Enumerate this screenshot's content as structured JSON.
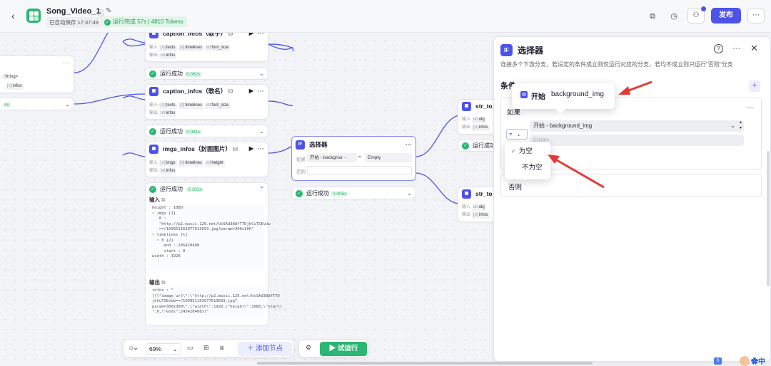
{
  "header": {
    "title": "Song_Video_1",
    "saved_text": "已自动保存 17:37:49",
    "run_status": "运行完成 57s | 4810 Tokens",
    "publish_label": "发布"
  },
  "left_stub": {
    "row1": "String>",
    "row2": "infos",
    "status_time": "4s"
  },
  "nodes": [
    {
      "title": "caption_infos（歌手）",
      "inputs_label": "输入",
      "inputs": [
        "texts",
        "timelines",
        "font_size"
      ],
      "outputs_label": "输出",
      "outputs": [
        "infos"
      ],
      "status": "运行成功",
      "time": "0.082s"
    },
    {
      "title": "caption_infos（歌名）",
      "inputs_label": "输入",
      "inputs": [
        "texts",
        "timelines",
        "font_size"
      ],
      "outputs_label": "输出",
      "outputs": [
        "infos"
      ],
      "status": "运行成功",
      "time": "0.081s"
    },
    {
      "title": "imgs_infos（封面图片）",
      "inputs_label": "输入",
      "inputs": [
        "imgs",
        "timelines",
        "height"
      ],
      "outputs_label": "输出",
      "outputs": [
        "infos"
      ],
      "status": "运行成功",
      "time": "0.101s"
    }
  ],
  "detail": {
    "input_label": "输入",
    "input_lines": [
      "height : 1080",
      "▿ imgs [1]",
      "   0 :",
      "   \"http://p2.music.126.net/UsSAd3BdfT7DjhCuTSEvUw",
      "   ==/109951163077613693.jpg?param=300x300\"",
      "▿ timelines [1]",
      "  ▿ 0 {2}",
      "     end : 245420408",
      "     start : 0",
      "width : 1920"
    ],
    "output_label": "输出",
    "output_lines": [
      "infos : \"",
      "[{\\\"image_url\\\":\\\"http://p2.music.126.net/UsSAd3BdfT7D",
      "jhCuTSEvUw==/109951163077613693.jpg?",
      "param=300x300\\\",\\\"width\\\":1920,\\\"height\\\":1080,\\\"start\\",
      "\":0,\\\"end\\\":245420408}]\""
    ]
  },
  "selector_node": {
    "title": "选择器",
    "cond_label": "如果",
    "cond_var": "开始 - backgrou···",
    "cond_op": "=",
    "cond_value": "Empty",
    "else_label": "否则",
    "status": "运行成功",
    "time": "0.005s"
  },
  "str_nodes": [
    {
      "title": "str_to_",
      "inputs_label": "输入",
      "inputs": [
        "obj"
      ],
      "outputs_label": "输出",
      "outputs": [
        "infos"
      ],
      "status": "运行成功"
    },
    {
      "title": "str_to_",
      "inputs_label": "输入",
      "inputs": [
        "obj"
      ],
      "outputs_label": "输出",
      "outputs": [
        "infos"
      ]
    }
  ],
  "panel": {
    "icon": "IF",
    "title": "选择器",
    "description": "连接多个下游分支，若设定的条件成立则仅运行对应的分支，若均不成立则只运行\"否则\"分支",
    "section_label": "条件",
    "if_label": "如果",
    "variable": "开始 - background_img",
    "else_label": "否则",
    "empty_placeholder": "Empty"
  },
  "tooltip": {
    "prefix": "开始",
    "variable": "background_img"
  },
  "dropdown": {
    "options": [
      "为空",
      "不为空"
    ],
    "selected": "为空"
  },
  "toolbar": {
    "zoom": "69%",
    "add_node": "添加节点",
    "test_run": "试运行"
  },
  "ime": {
    "label": "中"
  },
  "colors": {
    "accent": "#4d53e8",
    "success": "#2bb673",
    "annotation": "#e53935"
  }
}
